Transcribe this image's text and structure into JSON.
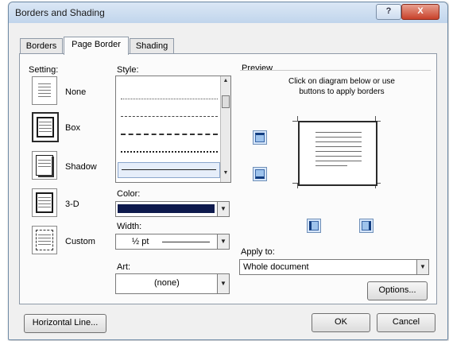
{
  "window": {
    "title": "Borders and Shading",
    "help_label": "?",
    "close_label": "X"
  },
  "tabs": [
    {
      "label": "Borders",
      "active": false
    },
    {
      "label": "Page Border",
      "active": true
    },
    {
      "label": "Shading",
      "active": false
    }
  ],
  "setting": {
    "heading": "Setting:",
    "options": [
      {
        "label": "None",
        "icon": "setting-none-icon",
        "selected": false
      },
      {
        "label": "Box",
        "icon": "setting-box-icon",
        "selected": true
      },
      {
        "label": "Shadow",
        "icon": "setting-shadow-icon",
        "selected": false
      },
      {
        "label": "3-D",
        "icon": "setting-3d-icon",
        "selected": false
      },
      {
        "label": "Custom",
        "icon": "setting-custom-icon",
        "selected": false
      }
    ]
  },
  "style": {
    "heading": "Style:",
    "options": [
      "dotted",
      "dashed",
      "long-dash",
      "dash-dot",
      "solid"
    ],
    "selected": "solid"
  },
  "color": {
    "label": "Color:",
    "value_color": "#0e1a4d"
  },
  "width": {
    "label": "Width:",
    "value": "½ pt"
  },
  "art": {
    "label": "Art:",
    "value": "(none)"
  },
  "preview": {
    "heading": "Preview",
    "instructions": "Click on diagram below or use buttons to apply borders",
    "apply_to_label": "Apply to:",
    "apply_to_value": "Whole document",
    "options_button": "Options..."
  },
  "footer": {
    "horizontal_line_button": "Horizontal Line...",
    "ok_button": "OK",
    "cancel_button": "Cancel"
  },
  "colors": {
    "accent": "#2f6fd0",
    "border_color": "#0e1a4d",
    "close_red": "#c8412a"
  }
}
